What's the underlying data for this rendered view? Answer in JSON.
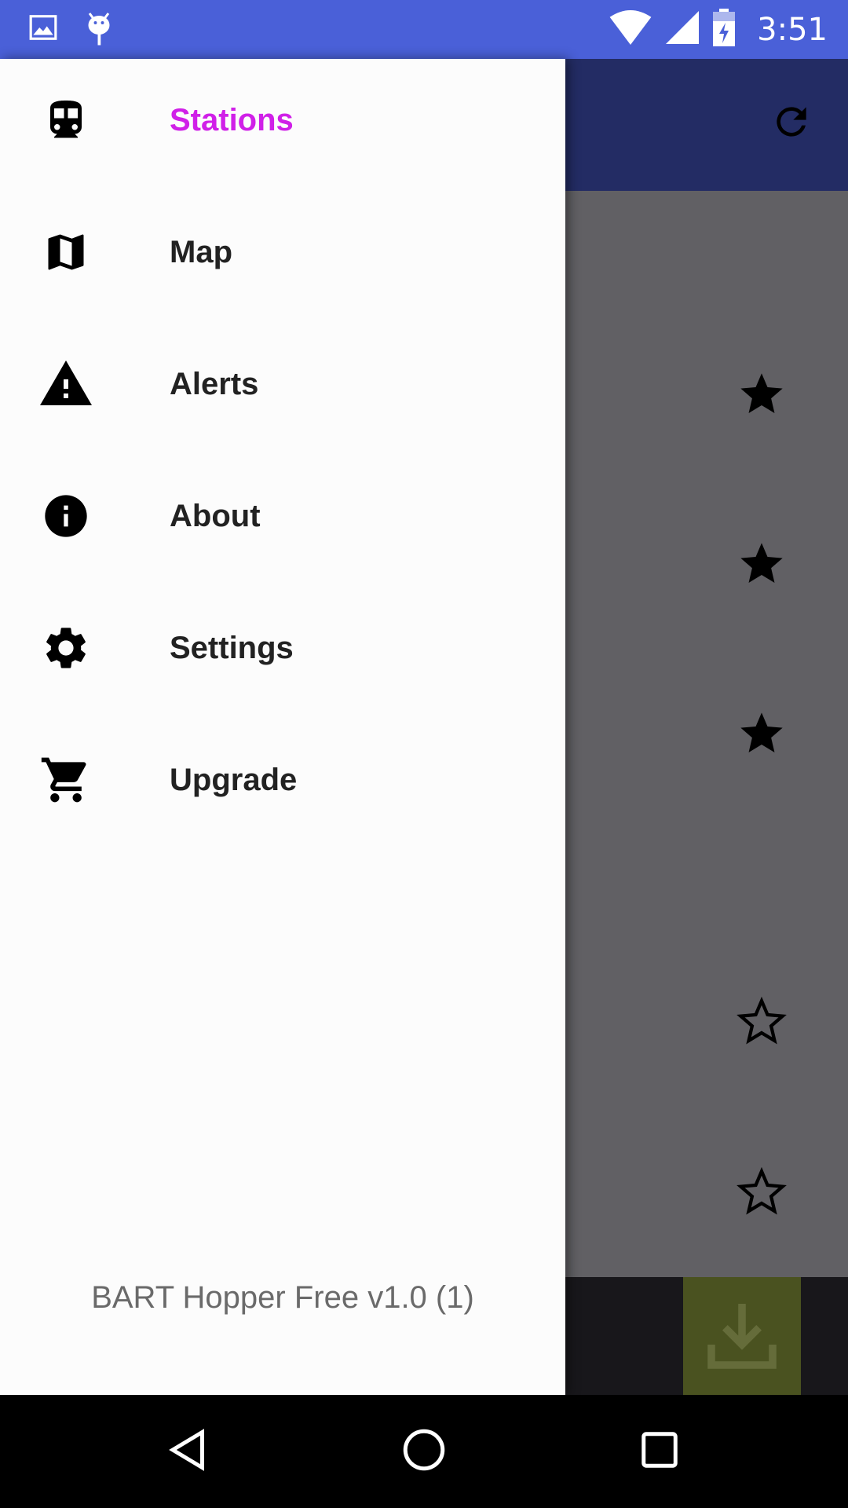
{
  "status_bar": {
    "time": "3:51",
    "left_icons": [
      "image-icon",
      "android-debug-icon"
    ],
    "right_icons": [
      "wifi-icon",
      "cell-signal-icon",
      "battery-charging-icon"
    ]
  },
  "drawer": {
    "items": [
      {
        "label": "Stations",
        "icon": "train-icon",
        "active": true
      },
      {
        "label": "Map",
        "icon": "map-icon",
        "active": false
      },
      {
        "label": "Alerts",
        "icon": "warning-icon",
        "active": false
      },
      {
        "label": "About",
        "icon": "info-icon",
        "active": false
      },
      {
        "label": "Settings",
        "icon": "gear-icon",
        "active": false
      },
      {
        "label": "Upgrade",
        "icon": "cart-icon",
        "active": false
      }
    ],
    "version": "BART Hopper Free v1.0 (1)"
  },
  "background_app": {
    "toolbar_action_icon": "refresh-icon",
    "favorite_states": [
      true,
      true,
      true,
      false,
      false
    ],
    "fab_icon": "download-icon"
  },
  "colors": {
    "status_bar": "#4a60d8",
    "toolbar": "#232c64",
    "accent_active": "#d020e8",
    "fab": "#4a5220"
  },
  "nav_bar": {
    "buttons": [
      "back-icon",
      "home-icon",
      "recents-icon"
    ]
  }
}
